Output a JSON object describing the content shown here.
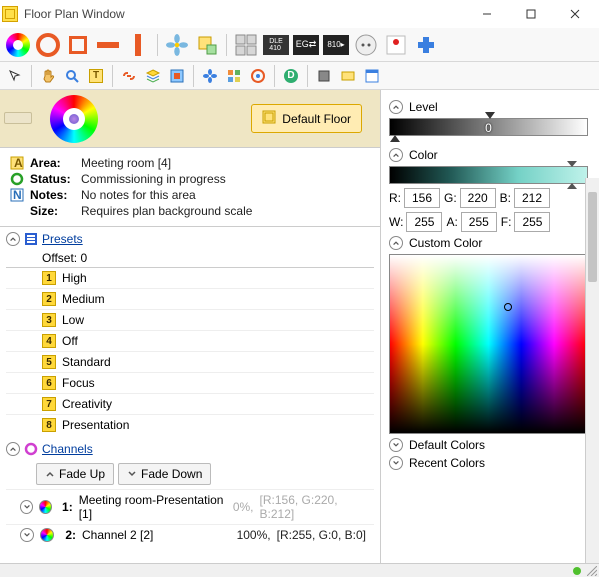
{
  "window": {
    "title": "Floor Plan Window"
  },
  "floor": {
    "default_button": "Default Floor"
  },
  "info": {
    "area_label": "Area:",
    "area_value": "Meeting room [4]",
    "status_label": "Status:",
    "status_value": "Commissioning in progress",
    "notes_label": "Notes:",
    "notes_value": "No notes for this area",
    "size_label": "Size:",
    "size_value": "Requires plan background scale"
  },
  "presets": {
    "header": "Presets",
    "offset": "Offset:  0",
    "items": [
      "High",
      "Medium",
      "Low",
      "Off",
      "Standard",
      "Focus",
      "Creativity",
      "Presentation"
    ]
  },
  "channels": {
    "header": "Channels",
    "fade_up": "Fade Up",
    "fade_down": "Fade Down",
    "rows": [
      {
        "id": "1:",
        "name": "Meeting room-Presentation [1]",
        "percent": "0%,",
        "rgb": "[R:156, G:220, B:212]"
      },
      {
        "id": "2:",
        "name": "Channel 2 [2]",
        "percent": "100%,",
        "rgb": "[R:255, G:0, B:0]"
      }
    ]
  },
  "picker": {
    "level_label": "Level",
    "level_value": "0",
    "color_label": "Color",
    "R_label": "R:",
    "R": "156",
    "G_label": "G:",
    "G": "220",
    "B_label": "B:",
    "B": "212",
    "W_label": "W:",
    "W": "255",
    "A_label": "A:",
    "A": "255",
    "F_label": "F:",
    "F": "255",
    "custom_label": "Custom Color",
    "default_colors": "Default Colors",
    "recent_colors": "Recent Colors"
  }
}
